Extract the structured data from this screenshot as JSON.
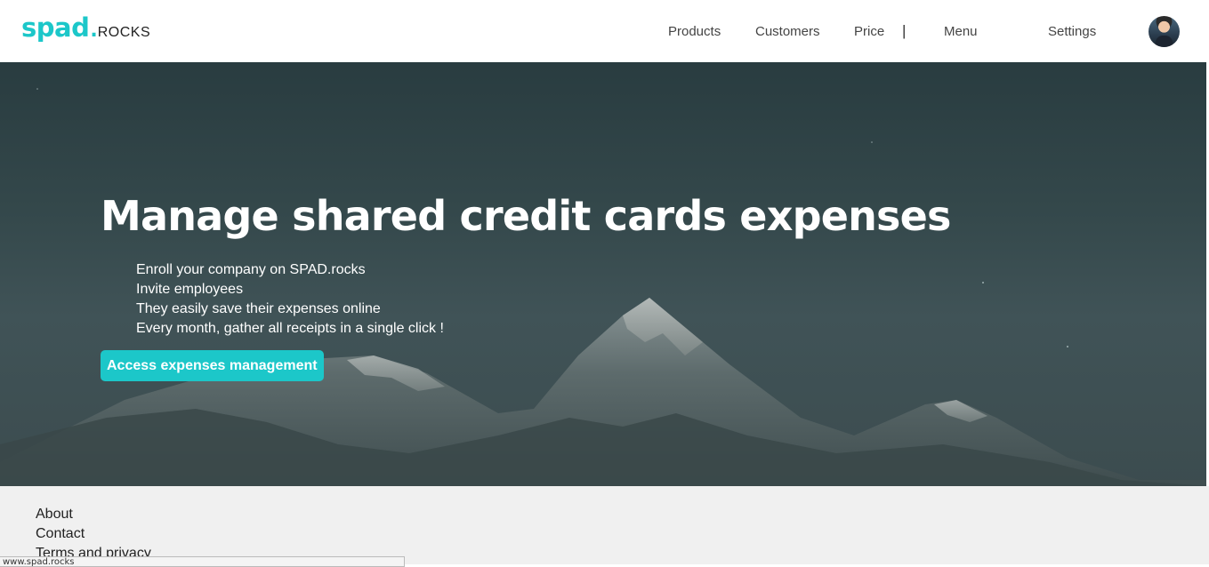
{
  "header": {
    "logo_main": "spad",
    "logo_dot": ".",
    "logo_sub": "ROCKS",
    "nav": {
      "products": "Products",
      "customers": "Customers",
      "price": "Price",
      "separator": "|",
      "menu": "Menu",
      "settings": "Settings"
    }
  },
  "hero": {
    "title": "Manage shared credit cards expenses",
    "steps": [
      "Enroll your company on SPAD.rocks",
      "Invite employees",
      "They easily save their expenses online",
      "Every month, gather all receipts in a single click !"
    ],
    "cta_label": "Access expenses management"
  },
  "footer": {
    "links": [
      "About",
      "Contact",
      "Terms and privacy"
    ]
  },
  "status_bar": {
    "url": "www.spad.rocks"
  },
  "colors": {
    "accent": "#1cc7c9",
    "footer_bg": "#f0f0f0"
  }
}
